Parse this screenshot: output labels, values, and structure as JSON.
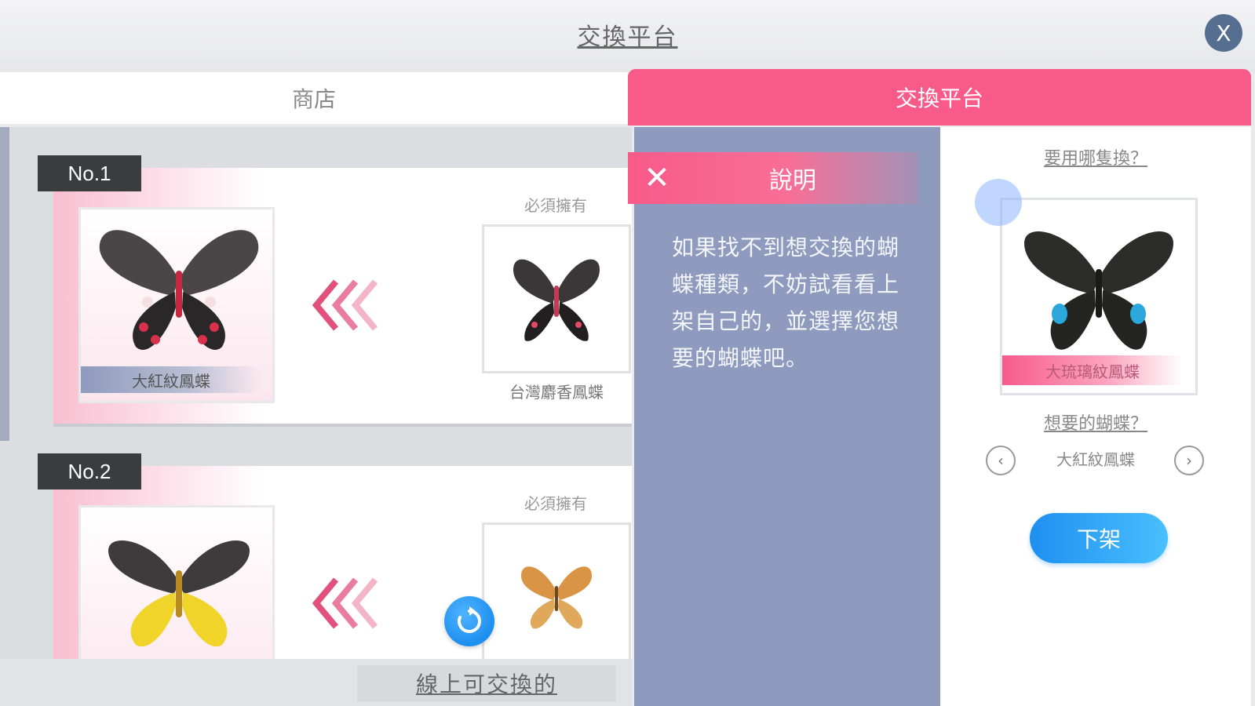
{
  "header": {
    "title": "交換平台",
    "close_label": "X"
  },
  "tabs": [
    {
      "label": "商店",
      "active": false
    },
    {
      "label": "交換平台",
      "active": true
    }
  ],
  "listings": [
    {
      "number": "No.1",
      "offered_name": "大紅紋鳳蝶",
      "required_label": "必須擁有",
      "required_name": "台灣麝香鳳蝶"
    },
    {
      "number": "No.2",
      "offered_name": "",
      "required_label": "必須擁有",
      "required_name": ""
    }
  ],
  "info": {
    "close_label": "✕",
    "title": "說明",
    "body": "如果找不到想交換的蝴蝶種類，不妨試看看上架自己的，並選擇您想要的蝴蝶吧。"
  },
  "right_panel": {
    "offer_question": "要用哪隻換？",
    "offer_name": "大琉璃紋鳳蝶",
    "want_question": "想要的蝴蝶？",
    "selected_want": "大紅紋鳳蝶",
    "action_label": "下架"
  },
  "footer": {
    "link_label": "線上可交換的"
  },
  "colors": {
    "accent_pink": "#f85a8a",
    "panel_blue": "#8e9bbe",
    "button_blue": "#1f8ff0"
  },
  "icons": {
    "close": "close-icon",
    "refresh": "refresh-icon",
    "prev": "chevron-left-icon",
    "next": "chevron-right-icon"
  }
}
